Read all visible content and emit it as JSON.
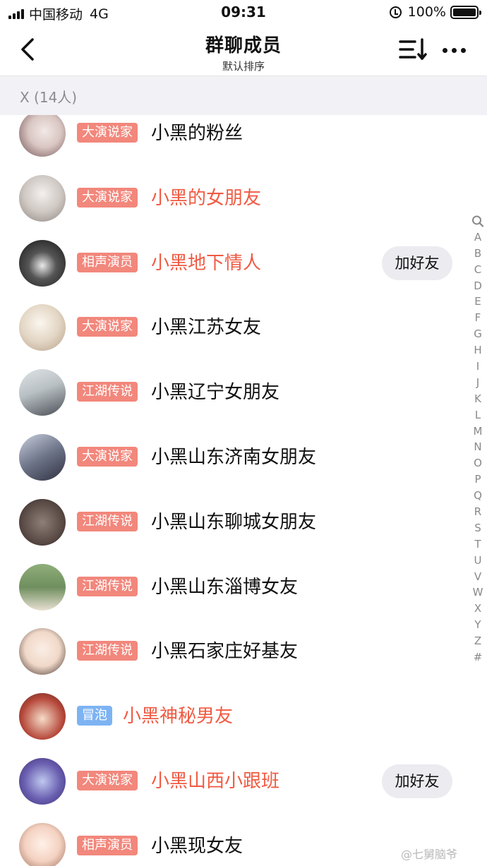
{
  "status_bar": {
    "carrier": "中国移动",
    "network": "4G",
    "time": "09:31",
    "battery": "100%"
  },
  "nav": {
    "title": "群聊成员",
    "subtitle": "默认排序"
  },
  "section": {
    "label": "X (14人)"
  },
  "members": [
    {
      "badge": "大演说家",
      "badge_color": "#f2877c",
      "name": "小黑的粉丝",
      "highlight": false,
      "add_friend": ""
    },
    {
      "badge": "大演说家",
      "badge_color": "#f2877c",
      "name": "小黑的女朋友",
      "highlight": true,
      "add_friend": ""
    },
    {
      "badge": "相声演员",
      "badge_color": "#f2877c",
      "name": "小黑地下情人",
      "highlight": true,
      "add_friend": "加好友"
    },
    {
      "badge": "大演说家",
      "badge_color": "#f2877c",
      "name": "小黑江苏女友",
      "highlight": false,
      "add_friend": ""
    },
    {
      "badge": "江湖传说",
      "badge_color": "#f2877c",
      "name": "小黑辽宁女朋友",
      "highlight": false,
      "add_friend": ""
    },
    {
      "badge": "大演说家",
      "badge_color": "#f2877c",
      "name": "小黑山东济南女朋友",
      "highlight": false,
      "add_friend": ""
    },
    {
      "badge": "江湖传说",
      "badge_color": "#f2877c",
      "name": "小黑山东聊城女朋友",
      "highlight": false,
      "add_friend": ""
    },
    {
      "badge": "江湖传说",
      "badge_color": "#f2877c",
      "name": "小黑山东淄博女友",
      "highlight": false,
      "add_friend": ""
    },
    {
      "badge": "江湖传说",
      "badge_color": "#f2877c",
      "name": "小黑石家庄好基友",
      "highlight": false,
      "add_friend": ""
    },
    {
      "badge": "冒泡",
      "badge_color": "#7db3f3",
      "name": "小黑神秘男友",
      "highlight": true,
      "add_friend": ""
    },
    {
      "badge": "大演说家",
      "badge_color": "#f2877c",
      "name": "小黑山西小跟班",
      "highlight": true,
      "add_friend": "加好友"
    },
    {
      "badge": "相声演员",
      "badge_color": "#f2877c",
      "name": "小黑现女友",
      "highlight": false,
      "add_friend": ""
    }
  ],
  "index_letters": [
    "A",
    "B",
    "C",
    "D",
    "E",
    "F",
    "G",
    "H",
    "I",
    "J",
    "K",
    "L",
    "M",
    "N",
    "O",
    "P",
    "Q",
    "R",
    "S",
    "T",
    "U",
    "V",
    "W",
    "X",
    "Y",
    "Z",
    "#"
  ],
  "watermark": "@七舅脑爷",
  "colors": {
    "highlight_name": "#f05a42",
    "badge_red": "#f2877c",
    "badge_blue": "#7db3f3",
    "section_bg": "#f2f2f6"
  }
}
